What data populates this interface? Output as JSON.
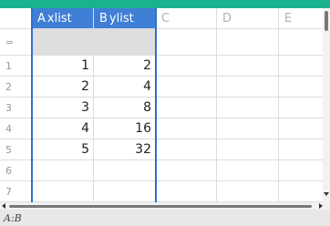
{
  "columns": [
    {
      "letter": "A",
      "name": "xlist"
    },
    {
      "letter": "B",
      "name": "ylist"
    },
    {
      "letter": "C",
      "name": ""
    },
    {
      "letter": "D",
      "name": ""
    },
    {
      "letter": "E",
      "name": ""
    }
  ],
  "formula_row_label": "=",
  "rows": [
    {
      "num": "1",
      "a": "1",
      "b": "2"
    },
    {
      "num": "2",
      "a": "2",
      "b": "4"
    },
    {
      "num": "3",
      "a": "3",
      "b": "8"
    },
    {
      "num": "4",
      "a": "4",
      "b": "16"
    },
    {
      "num": "5",
      "a": "5",
      "b": "32"
    },
    {
      "num": "6",
      "a": "",
      "b": ""
    },
    {
      "num": "7",
      "a": "",
      "b": ""
    }
  ],
  "status": {
    "selection": "A:B"
  },
  "colors": {
    "accent": "#1bb38f",
    "selection": "#3f7fd6"
  }
}
